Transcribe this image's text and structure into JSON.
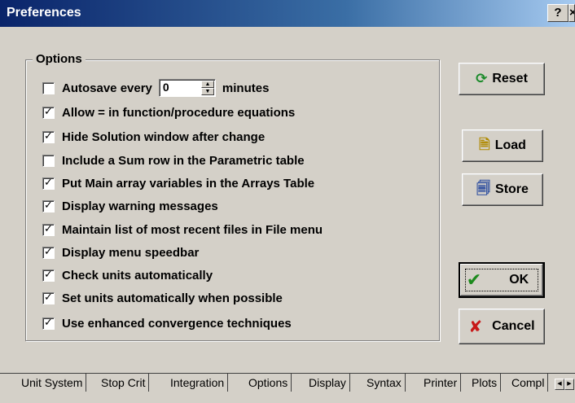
{
  "window": {
    "title": "Preferences",
    "help_label": "?",
    "close_label": "×"
  },
  "options": {
    "group_label": "Options",
    "autosave": {
      "label_before": "Autosave every",
      "value": "0",
      "label_after": "minutes",
      "checked": false
    },
    "items": [
      {
        "label": "Allow = in function/procedure equations",
        "checked": true
      },
      {
        "label": "Hide Solution window after change",
        "checked": true
      },
      {
        "label": "Include a Sum row in the Parametric table",
        "checked": false
      },
      {
        "label": "Put Main array variables in the Arrays Table",
        "checked": true
      },
      {
        "label": "Display warning messages",
        "checked": true
      },
      {
        "label": "Maintain list of most recent files in File menu",
        "checked": true
      },
      {
        "label": "Display menu speedbar",
        "checked": true
      },
      {
        "label": "Check units automatically",
        "checked": true
      },
      {
        "label": "Set units automatically when possible",
        "checked": true
      },
      {
        "label": "Use enhanced convergence techniques",
        "checked": true
      }
    ]
  },
  "buttons": {
    "reset": "Reset",
    "load": "Load",
    "store": "Store",
    "ok": "OK",
    "cancel": "Cancel"
  },
  "tabs": [
    "Unit System",
    "Stop Crit",
    "Integration",
    "Options",
    "Display",
    "Syntax",
    "Printer",
    "Plots",
    "Compl"
  ],
  "active_tab": "Options",
  "colors": {
    "title_start": "#0a246a",
    "title_end": "#a6caf0",
    "face": "#d4d0c8",
    "ok_check": "#1c8a1c",
    "cancel_x": "#c81818",
    "reset_arrows": "#1a8a2a"
  }
}
